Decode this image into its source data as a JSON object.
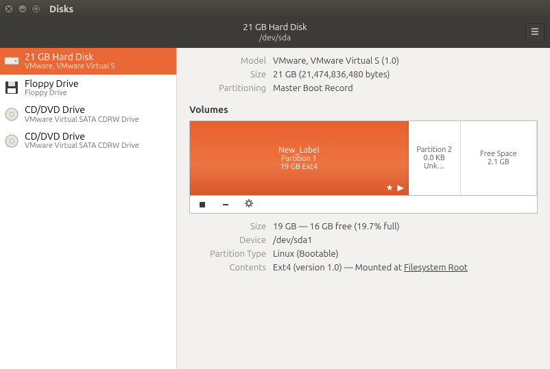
{
  "window": {
    "title": "Disks"
  },
  "header": {
    "title_line1": "21 GB Hard Disk",
    "title_line2": "/dev/sda"
  },
  "sidebar": {
    "items": [
      {
        "title": "21 GB Hard Disk",
        "sub": "VMware, VMware Virtual S",
        "icon": "hdd"
      },
      {
        "title": "Floppy Drive",
        "sub": "Floppy Drive",
        "icon": "floppy"
      },
      {
        "title": "CD/DVD Drive",
        "sub": "VMware Virtual SATA CDRW Drive",
        "icon": "disc"
      },
      {
        "title": "CD/DVD Drive",
        "sub": "VMware Virtual SATA CDRW Drive",
        "icon": "disc"
      }
    ]
  },
  "disk": {
    "labels": {
      "model": "Model",
      "size": "Size",
      "partitioning": "Partitioning"
    },
    "model": "VMware, VMware Virtual S (1.0)",
    "size": "21 GB (21,474,836,480 bytes)",
    "partitioning": "Master Boot Record"
  },
  "volumes_header": "Volumes",
  "volumes": {
    "main": {
      "label": "New_Label",
      "partition": "Partition 1",
      "size_fs": "19 GB Ext4"
    },
    "p2": {
      "label": "Partition 2",
      "size": "0.0 KB Unk…"
    },
    "free": {
      "label": "Free Space",
      "size": "2.1 GB"
    }
  },
  "partition": {
    "labels": {
      "size": "Size",
      "device": "Device",
      "ptype": "Partition Type",
      "contents": "Contents"
    },
    "size": "19 GB — 16 GB free (19.7% full)",
    "device": "/dev/sda1",
    "ptype": "Linux (Bootable)",
    "contents_prefix": "Ext4 (version 1.0) — Mounted at ",
    "contents_link": "Filesystem Root"
  }
}
